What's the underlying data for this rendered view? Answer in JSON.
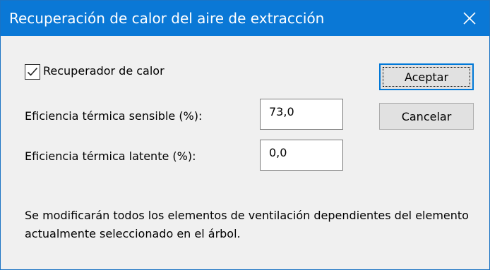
{
  "window": {
    "title": "Recuperación de calor del aire de extracción",
    "close_icon": "close-icon",
    "titlebar_color": "#0a78d6"
  },
  "form": {
    "checkbox_label": "Recuperador de calor",
    "checkbox_checked": true,
    "sensible_label": "Eficiencia térmica sensible (%):",
    "sensible_value": "73,0",
    "latente_label": "Eficiencia térmica latente (%):",
    "latente_value": "0,0"
  },
  "buttons": {
    "ok_label": "Aceptar",
    "cancel_label": "Cancelar"
  },
  "info_text": "Se modificarán todos los elementos de ventilación dependientes del elemento actualmente seleccionado en el árbol."
}
